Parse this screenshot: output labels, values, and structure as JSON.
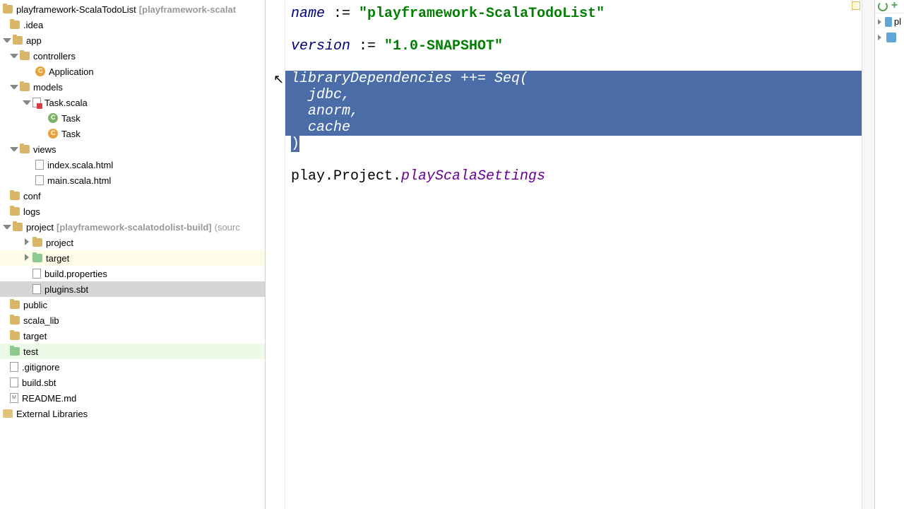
{
  "project": {
    "root_name": "playframework-ScalaTodoList",
    "root_suffix": "[playframework-scalat",
    "idea": ".idea",
    "app": "app",
    "controllers": "controllers",
    "application": "Application",
    "models": "models",
    "task_scala": "Task.scala",
    "task1": "Task",
    "task2": "Task",
    "views": "views",
    "index_html": "index.scala.html",
    "main_html": "main.scala.html",
    "conf": "conf",
    "logs": "logs",
    "project_folder": "project",
    "project_suffix": "[playframework-scalatodolist-build]",
    "project_extra": "(sourc",
    "project_sub": "project",
    "target_sub": "target",
    "build_props": "build.properties",
    "plugins_sbt": "plugins.sbt",
    "public": "public",
    "scala_lib": "scala_lib",
    "target": "target",
    "test": "test",
    "gitignore": ".gitignore",
    "build_sbt": "build.sbt",
    "readme": "README.md",
    "ext_lib": "External Libraries"
  },
  "code": {
    "line1_name": "name",
    "line1_op": " := ",
    "line1_str": "\"playframework-ScalaTodoList\"",
    "line2_name": "version",
    "line2_op": " := ",
    "line2_str": "\"1.0-SNAPSHOT\"",
    "line3": "libraryDependencies ++= Seq(",
    "line4": "  jdbc,",
    "line5": "  anorm,",
    "line6": "  cache",
    "line7": ")",
    "line8_pkg": "play.Project.",
    "line8_set": "playScalaSettings"
  },
  "rail": {
    "pl": "pl"
  }
}
